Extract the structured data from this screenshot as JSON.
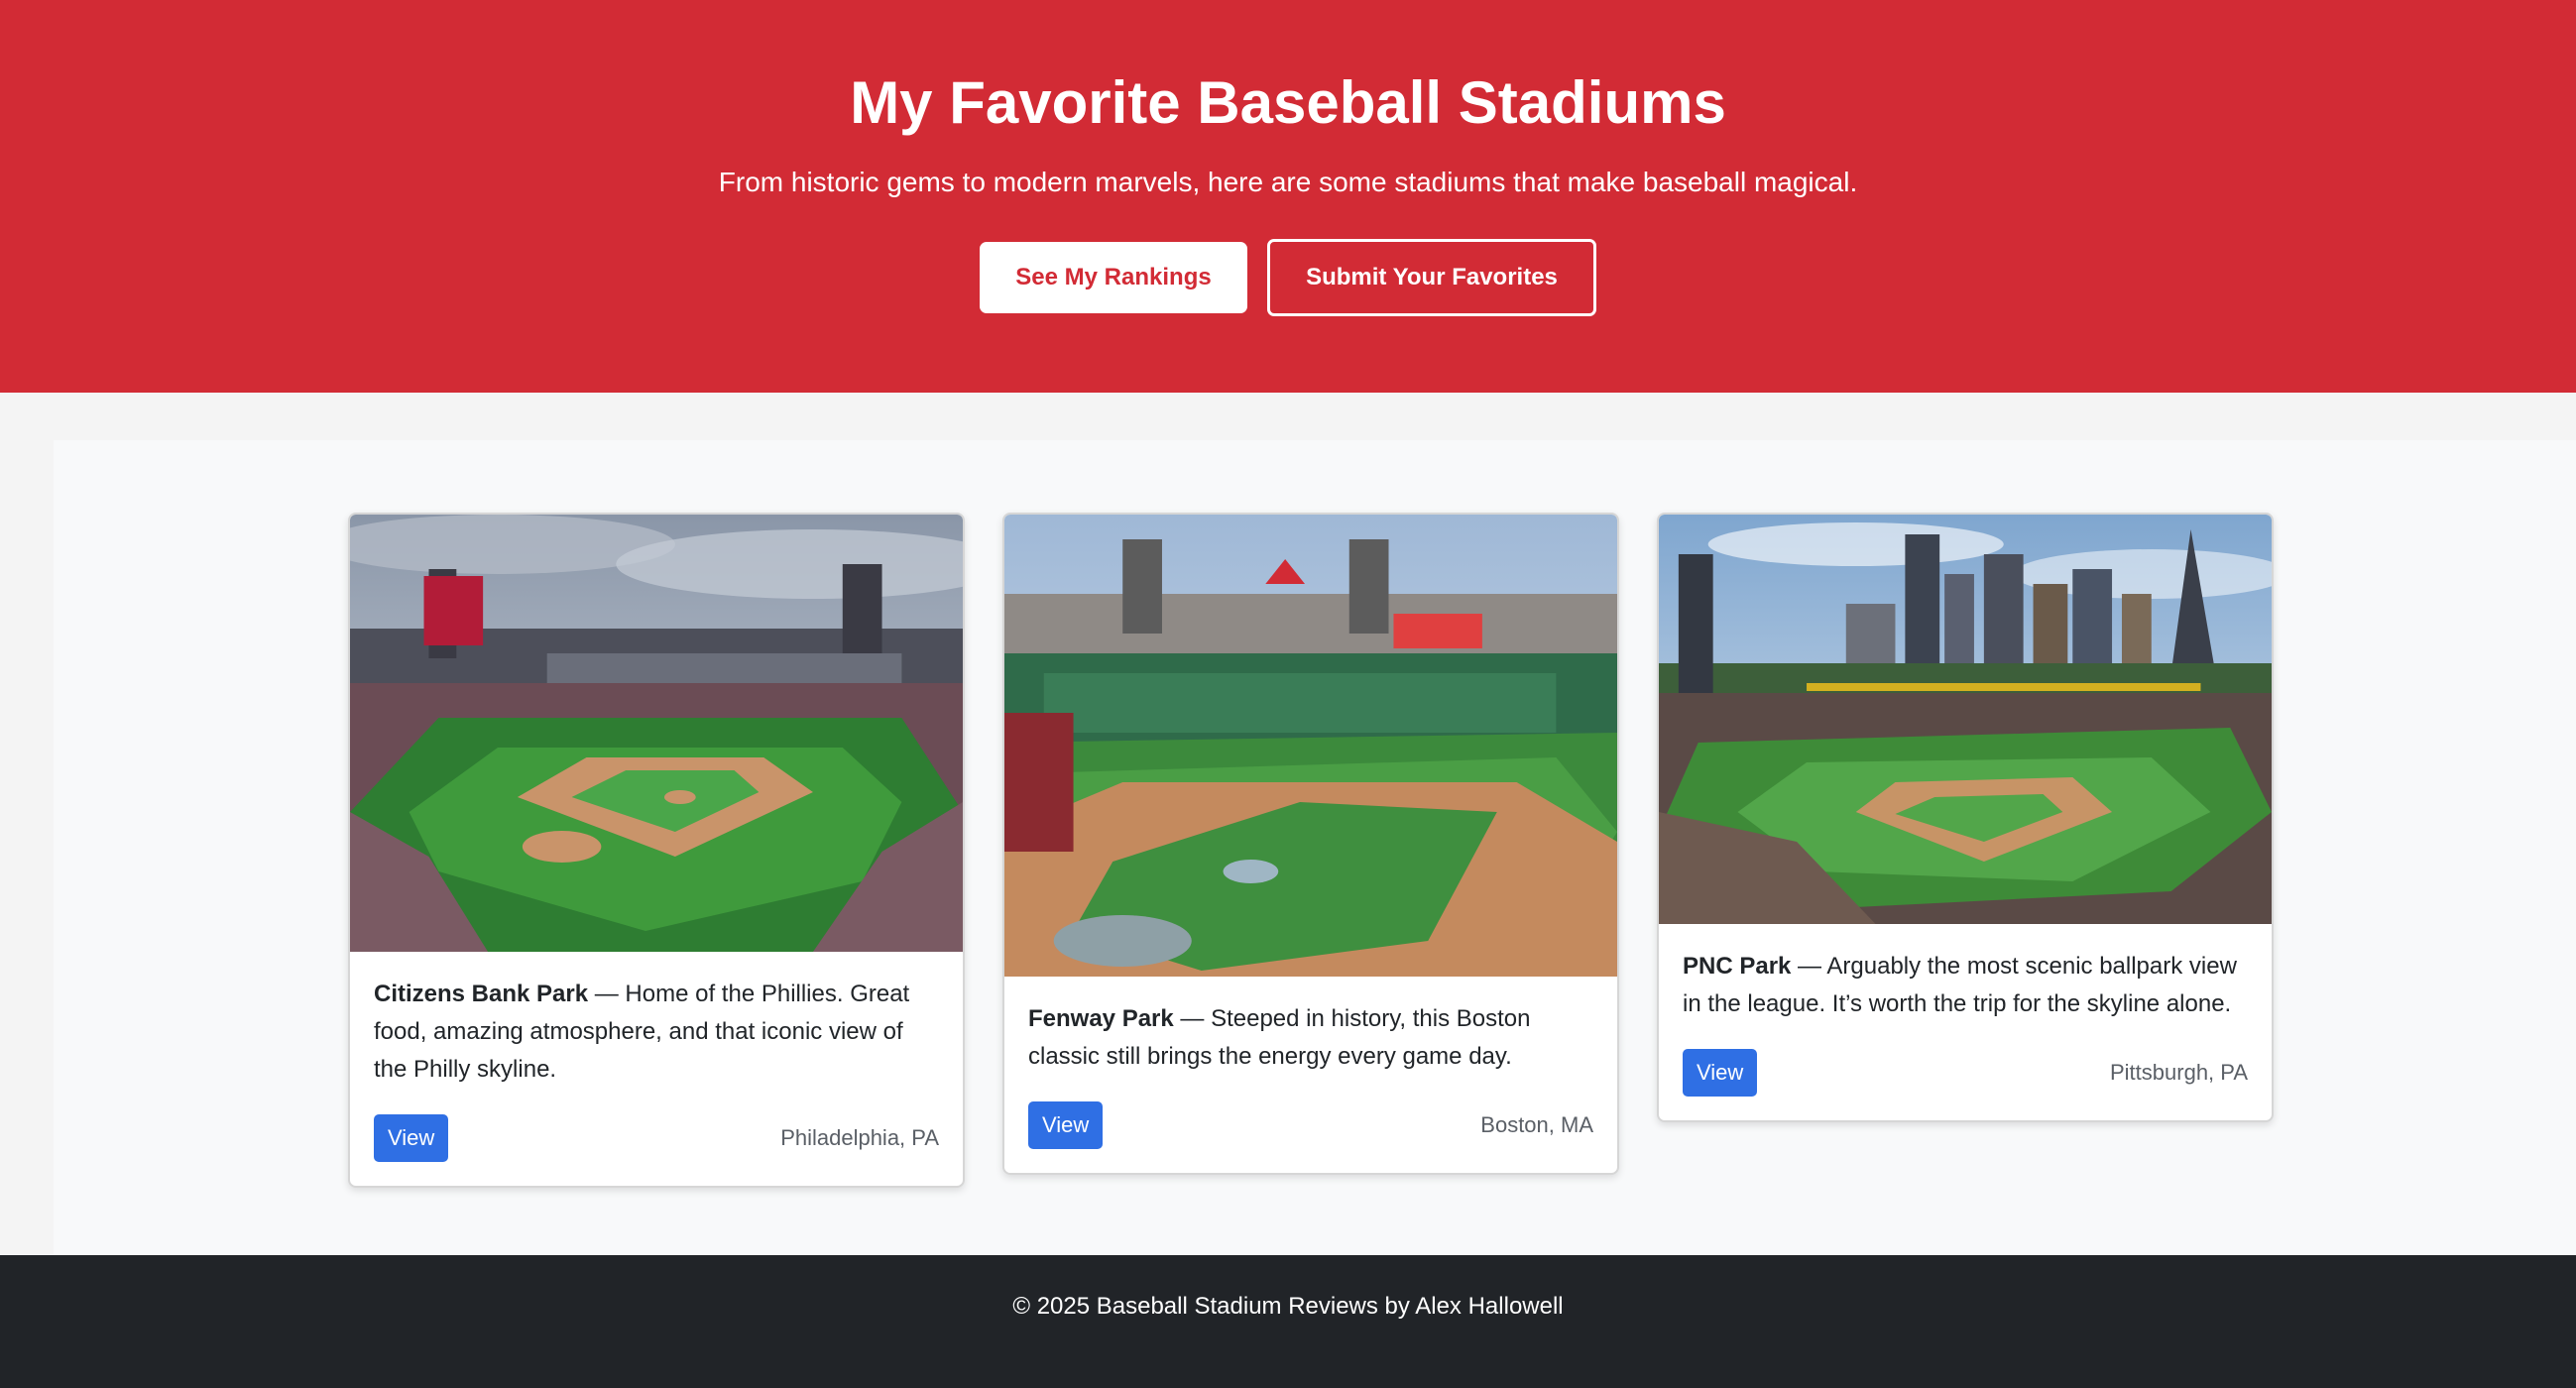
{
  "hero": {
    "title": "My Favorite Baseball Stadiums",
    "subtitle": "From historic gems to modern marvels, here are some stadiums that make baseball magical.",
    "primary_button": "See My Rankings",
    "secondary_button": "Submit Your Favorites",
    "color": "#d22b35"
  },
  "cards": [
    {
      "name": "Citizens Bank Park",
      "description": " — Home of the Phillies. Great food, amazing atmosphere, and that iconic view of the Philly skyline.",
      "button": "View",
      "location": "Philadelphia, PA",
      "image": "citizens-bank-park-photo"
    },
    {
      "name": "Fenway Park",
      "description": " — Steeped in history, this Boston classic still brings the energy every game day.",
      "button": "View",
      "location": "Boston, MA",
      "image": "fenway-park-photo"
    },
    {
      "name": "PNC Park",
      "description": " — Arguably the most scenic ballpark view in the league. It’s worth the trip for the skyline alone.",
      "button": "View",
      "location": "Pittsburgh, PA",
      "image": "pnc-park-photo"
    }
  ],
  "footer": {
    "text": "© 2025 Baseball Stadium Reviews by Alex Hallowell"
  },
  "colors": {
    "accent": "#d22b35",
    "view_button": "#2f6fe4",
    "footer_bg": "#212428"
  }
}
